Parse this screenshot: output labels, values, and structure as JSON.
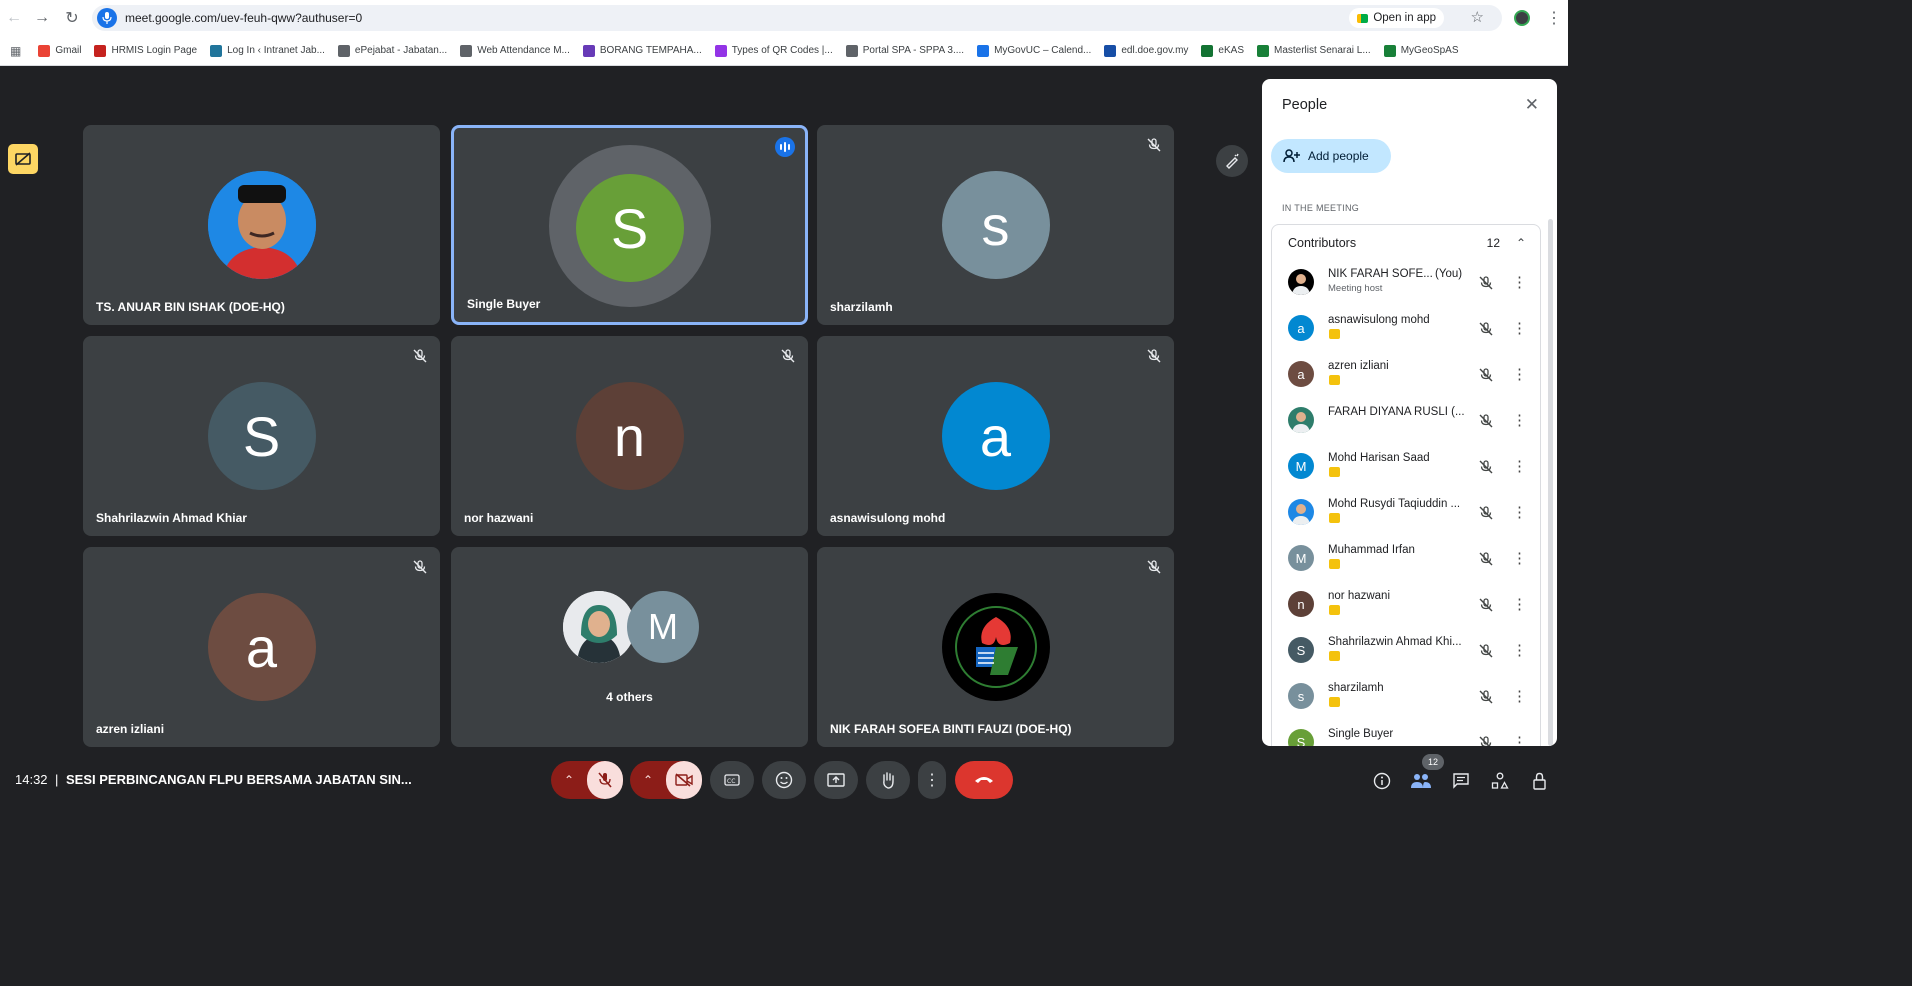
{
  "browser": {
    "url": "meet.google.com/uev-feuh-qww?authuser=0",
    "open_in_app": "Open in app",
    "bookmarks": [
      {
        "label": "Gmail",
        "color": "#ea4335"
      },
      {
        "label": "HRMIS Login Page",
        "color": "#c5221f"
      },
      {
        "label": "Log In ‹ Intranet Jab...",
        "color": "#21759b"
      },
      {
        "label": "ePejabat - Jabatan...",
        "color": "#5f6368"
      },
      {
        "label": "Web Attendance M...",
        "color": "#5f6368"
      },
      {
        "label": "BORANG TEMPAHA...",
        "color": "#673ab7"
      },
      {
        "label": "Types of QR Codes |...",
        "color": "#9334e6"
      },
      {
        "label": "Portal SPA - SPPA 3....",
        "color": "#5f6368"
      },
      {
        "label": "MyGovUC – Calend...",
        "color": "#1a73e8"
      },
      {
        "label": "edl.doe.gov.my",
        "color": "#174ea6"
      },
      {
        "label": "eKAS",
        "color": "#137333"
      },
      {
        "label": "Masterlist Senarai L...",
        "color": "#188038"
      },
      {
        "label": "MyGeoSpAS",
        "color": "#188038"
      }
    ]
  },
  "tiles": [
    {
      "name": "TS. ANUAR BIN ISHAK (DOE-HQ)",
      "initial": "",
      "color": "#1e88e5",
      "muted": false,
      "active": false,
      "photo": "man-photo"
    },
    {
      "name": "Single Buyer",
      "initial": "S",
      "color": "#689f38",
      "muted": false,
      "active": true,
      "photo": ""
    },
    {
      "name": "sharzilamh",
      "initial": "s",
      "color": "#78909c",
      "muted": true,
      "active": false,
      "photo": ""
    },
    {
      "name": "Shahrilazwin Ahmad Khiar",
      "initial": "S",
      "color": "#455a64",
      "muted": true,
      "active": false,
      "photo": ""
    },
    {
      "name": "nor hazwani",
      "initial": "n",
      "color": "#5d4037",
      "muted": true,
      "active": false,
      "photo": ""
    },
    {
      "name": "asnawisulong mohd",
      "initial": "a",
      "color": "#0288d1",
      "muted": true,
      "active": false,
      "photo": ""
    },
    {
      "name": "azren izliani",
      "initial": "a",
      "color": "#6d4c41",
      "muted": true,
      "active": false,
      "photo": ""
    },
    {
      "name": "4 others",
      "initial": "M",
      "color": "#78909c",
      "muted": false,
      "active": false,
      "photo": "group"
    },
    {
      "name": "NIK FARAH SOFEA BINTI FAUZI (DOE-HQ)",
      "initial": "",
      "color": "#000000",
      "muted": true,
      "active": false,
      "photo": "logo"
    }
  ],
  "people_panel": {
    "title": "People",
    "add_people": "Add people",
    "in_meeting": "IN THE MEETING",
    "contributors_label": "Contributors",
    "contributors_count": "12",
    "participants": [
      {
        "name": "NIK FARAH SOFE...",
        "you": "(You)",
        "sub": "Meeting host",
        "initial": "",
        "color": "#000000",
        "badge": false
      },
      {
        "name": "asnawisulong mohd",
        "you": "",
        "sub": "",
        "initial": "a",
        "color": "#0288d1",
        "badge": true
      },
      {
        "name": "azren izliani",
        "you": "",
        "sub": "",
        "initial": "a",
        "color": "#6d4c41",
        "badge": true
      },
      {
        "name": "FARAH DIYANA RUSLI (...",
        "you": "",
        "sub": "",
        "initial": "",
        "color": "#2e7d6b",
        "badge": false
      },
      {
        "name": "Mohd Harisan Saad",
        "you": "",
        "sub": "",
        "initial": "M",
        "color": "#0288d1",
        "badge": true
      },
      {
        "name": "Mohd Rusydi Taqiuddin ...",
        "you": "",
        "sub": "",
        "initial": "",
        "color": "#1e88e5",
        "badge": true
      },
      {
        "name": "Muhammad Irfan",
        "you": "",
        "sub": "",
        "initial": "M",
        "color": "#78909c",
        "badge": true
      },
      {
        "name": "nor hazwani",
        "you": "",
        "sub": "",
        "initial": "n",
        "color": "#5d4037",
        "badge": true
      },
      {
        "name": "Shahrilazwin Ahmad Khi...",
        "you": "",
        "sub": "",
        "initial": "S",
        "color": "#455a64",
        "badge": true
      },
      {
        "name": "sharzilamh",
        "you": "",
        "sub": "",
        "initial": "s",
        "color": "#78909c",
        "badge": true
      },
      {
        "name": "Single Buyer",
        "you": "",
        "sub": "",
        "initial": "S",
        "color": "#689f38",
        "badge": false
      }
    ]
  },
  "bottom": {
    "time": "14:32",
    "separator": "|",
    "meeting_title": "SESI PERBINCANGAN FLPU BERSAMA JABATAN SIN...",
    "people_count": "12"
  }
}
